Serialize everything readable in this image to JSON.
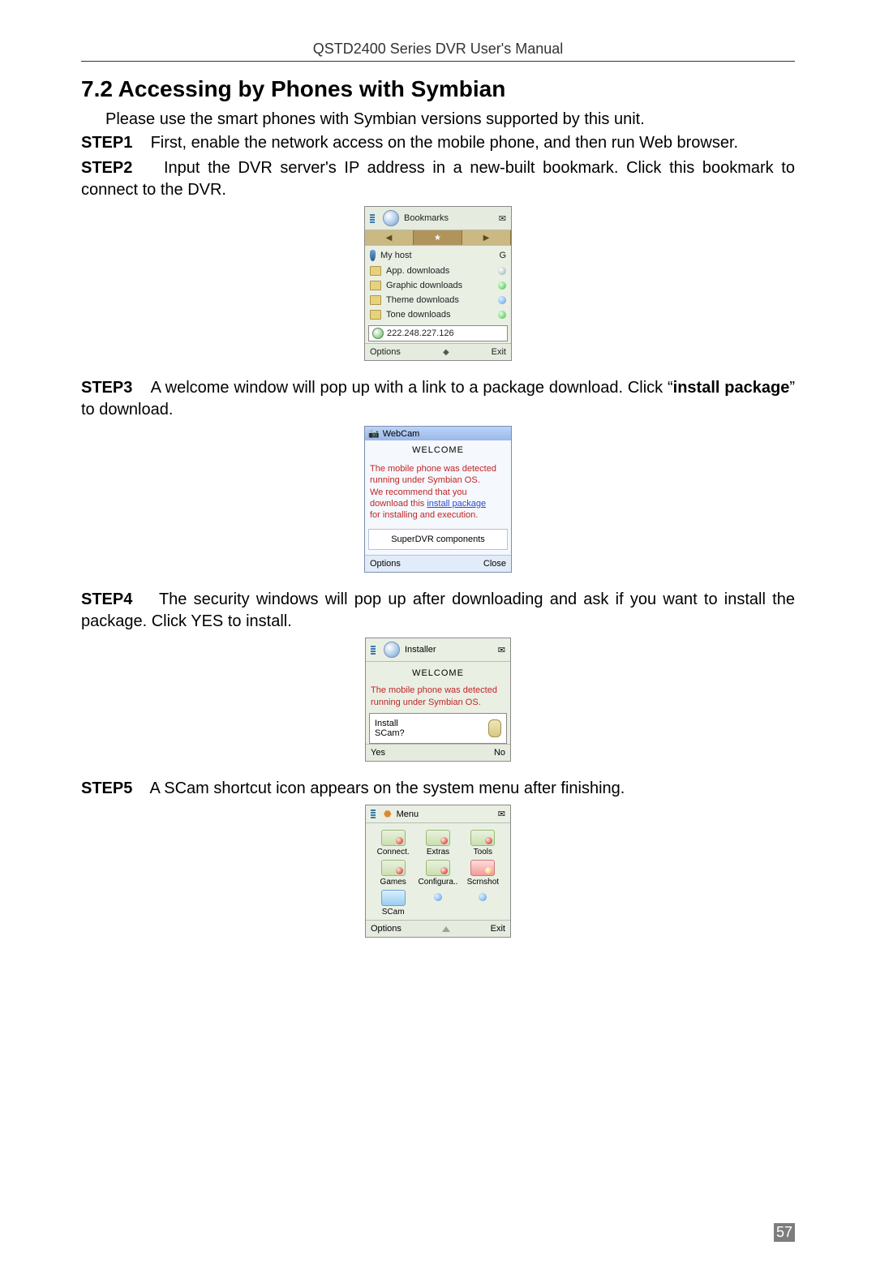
{
  "header": {
    "manual_title": "QSTD2400 Series DVR User's Manual"
  },
  "section": {
    "number_title": "7.2  Accessing by Phones with Symbian"
  },
  "intro": "Please use the smart phones with Symbian versions supported by this unit.",
  "steps": {
    "s1": {
      "label": "STEP1",
      "text": "First, enable the network access on the mobile phone, and then run Web browser."
    },
    "s2": {
      "label": "STEP2",
      "text": "Input the DVR server's IP address in a new-built bookmark. Click this bookmark to connect to the DVR."
    },
    "s3": {
      "label": "STEP3",
      "text_a": "A welcome window will pop up with a link to a package download. Click “",
      "link": "install package",
      "text_b": "” to download."
    },
    "s4": {
      "label": "STEP4",
      "text": "The security windows will pop up after downloading and ask if you want to install the package. Click YES to install."
    },
    "s5": {
      "label": "STEP5",
      "text": "A SCam shortcut icon appears on the system menu after finishing."
    }
  },
  "fig_bookmarks": {
    "title": "Bookmarks",
    "rows": {
      "myhost": "My host",
      "appdl": "App. downloads",
      "graphicdl": "Graphic downloads",
      "themedl": "Theme downloads",
      "tonedl": "Tone downloads"
    },
    "ip": "222.248.227.126",
    "g_badge": "G",
    "left_soft": "Options",
    "right_soft": "Exit"
  },
  "fig_webcam": {
    "titlebar_icon": "📷",
    "titlebar": "WebCam",
    "welcome": "WELCOME",
    "l1": "The mobile phone was detected",
    "l2": "running under Symbian OS.",
    "l3": "We recommend that you",
    "l4a": "download this ",
    "l4_link": "install package",
    "l5": "for installing and execution.",
    "components": "SuperDVR components",
    "left_soft": "Options",
    "right_soft": "Close"
  },
  "fig_installer": {
    "title": "Installer",
    "welcome": "WELCOME",
    "l1": "The mobile phone was detected",
    "l2": "running under Symbian OS.",
    "q1": "Install",
    "q2": "SCam?",
    "left_soft": "Yes",
    "right_soft": "No"
  },
  "fig_menu": {
    "title": "Menu",
    "items": {
      "connect": "Connect.",
      "extras": "Extras",
      "tools": "Tools",
      "games": "Games",
      "config": "Configura..",
      "scrnshot": "Scrnshot",
      "scam": "SCam"
    },
    "left_soft": "Options",
    "right_soft": "Exit"
  },
  "page_number": "57"
}
